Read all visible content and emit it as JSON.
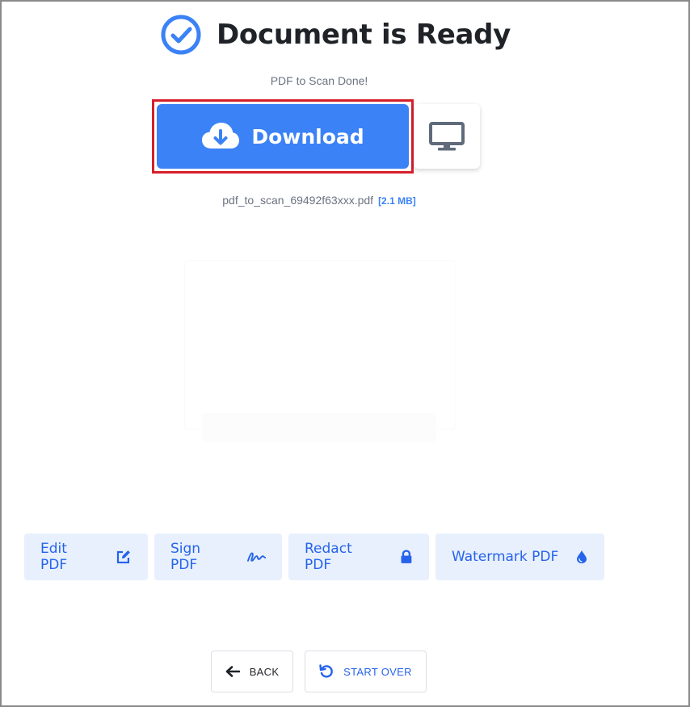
{
  "header": {
    "title": "Document is Ready",
    "subtitle": "PDF to Scan Done!"
  },
  "download": {
    "label": "Download",
    "icon": "cloud-download-icon"
  },
  "device_button": {
    "icon": "monitor-icon"
  },
  "file": {
    "name": "pdf_to_scan_69492f63xxx.pdf",
    "size": "[2.1 MB]"
  },
  "tools": [
    {
      "label": "Edit PDF",
      "icon": "edit-icon"
    },
    {
      "label": "Sign PDF",
      "icon": "signature-icon"
    },
    {
      "label": "Redact PDF",
      "icon": "lock-icon"
    },
    {
      "label": "Watermark PDF",
      "icon": "droplet-icon"
    }
  ],
  "nav": {
    "back_label": "BACK",
    "start_over_label": "START OVER"
  },
  "colors": {
    "accent": "#3b82f6",
    "highlight": "#d5202b",
    "tool_bg": "#e8f0fd"
  }
}
